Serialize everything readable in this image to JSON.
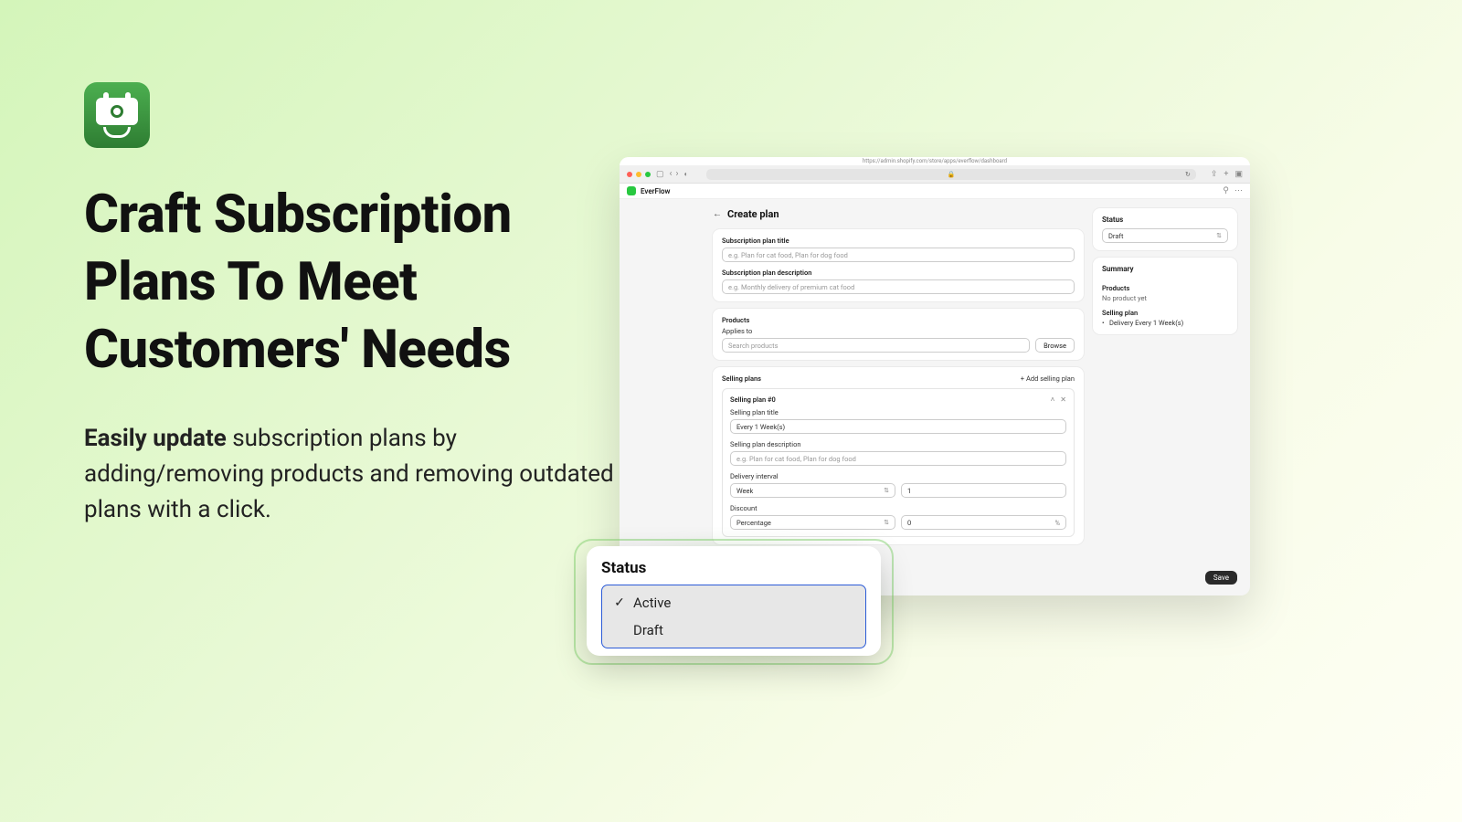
{
  "marketing": {
    "headline": "Craft Subscription Plans To Meet Customers' Needs",
    "subtext_strong": "Easily update",
    "subtext_rest": " subscription plans by adding/removing products and removing outdated plans with a click."
  },
  "browser": {
    "url": "https://admin.shopify.com/store/apps/everflow/dashboard",
    "app_name": "EverFlow"
  },
  "page": {
    "title": "Create plan",
    "subscription_title_label": "Subscription plan title",
    "subscription_title_placeholder": "e.g. Plan for cat food, Plan for dog food",
    "subscription_desc_label": "Subscription plan description",
    "subscription_desc_placeholder": "e.g. Monthly delivery of premium cat food",
    "products_heading": "Products",
    "applies_to_label": "Applies to",
    "search_placeholder": "Search products",
    "browse_label": "Browse",
    "selling_plans_heading": "Selling plans",
    "add_selling_label": "Add selling plan",
    "plan0_name": "Selling plan #0",
    "plan_title_label": "Selling plan title",
    "plan_title_value": "Every 1 Week(s)",
    "plan_desc_label": "Selling plan description",
    "plan_desc_placeholder": "e.g. Plan for cat food, Plan for dog food",
    "delivery_interval_label": "Delivery interval",
    "delivery_unit": "Week",
    "delivery_qty": "1",
    "discount_label": "Discount",
    "discount_type": "Percentage",
    "discount_value": "0",
    "discount_suffix": "%",
    "save_label": "Save"
  },
  "sidebar": {
    "status_heading": "Status",
    "status_value": "Draft",
    "summary_heading": "Summary",
    "products_heading": "Products",
    "products_empty": "No product yet",
    "selling_plan_heading": "Selling plan",
    "selling_plan_item": "Delivery Every 1 Week(s)"
  },
  "popover": {
    "title": "Status",
    "option_active": "Active",
    "option_draft": "Draft"
  }
}
